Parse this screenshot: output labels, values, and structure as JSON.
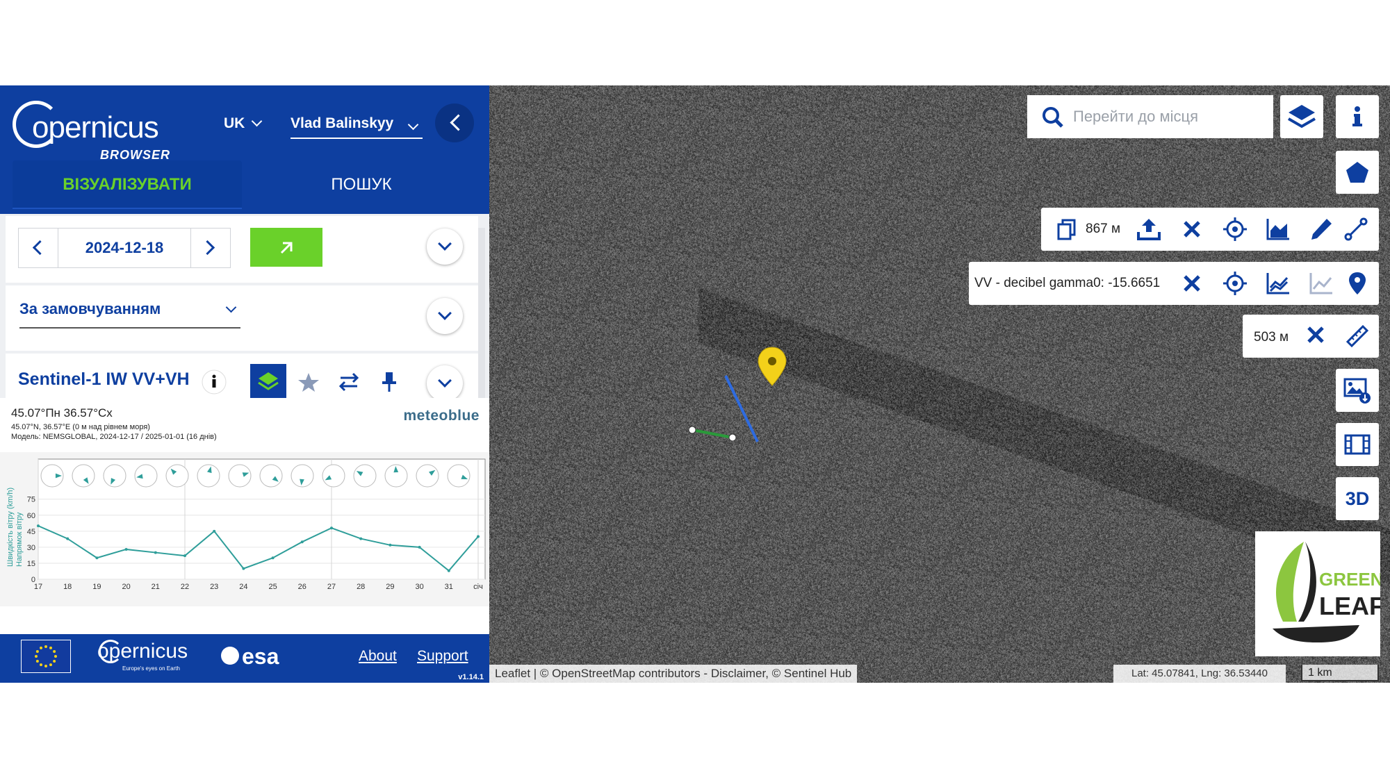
{
  "header": {
    "logo_text": "opernicus",
    "logo_sub": "BROWSER",
    "language": "UK",
    "user": "Vlad Balinskyy"
  },
  "tabs": {
    "visualize": "ВІЗУАЛІЗУВАТИ",
    "search": "ПОШУК"
  },
  "date_picker": {
    "value": "2024-12-18"
  },
  "theme": {
    "selected": "За замовчуванням"
  },
  "layer": {
    "title": "Sentinel-1 IW VV+VH"
  },
  "weather": {
    "location": "45.07°Пн 36.57°Сх",
    "coords_line": "45.07°N, 36.57°E (0 м над рівнем моря)",
    "model_line": "Модель: NEMSGLOBAL, 2024-12-17 / 2025-01-01 (16 днів)",
    "provider": "meteoblue",
    "y_axis_label1": "Швидкість вітру (km/h)",
    "y_axis_label2": "Напрямок вітру",
    "y_ticks": [
      "0",
      "15",
      "30",
      "45",
      "60",
      "75"
    ],
    "x_ticks": [
      "17",
      "18",
      "19",
      "20",
      "21",
      "22",
      "23",
      "24",
      "25",
      "26",
      "27",
      "28",
      "29",
      "30",
      "31",
      "січ"
    ]
  },
  "chart_data": {
    "type": "line",
    "x": [
      "17",
      "18",
      "19",
      "20",
      "21",
      "22",
      "23",
      "24",
      "25",
      "26",
      "27",
      "28",
      "29",
      "30",
      "31",
      "січ"
    ],
    "series": [
      {
        "values": [
          50,
          38,
          20,
          28,
          25,
          22,
          45,
          10,
          20,
          35,
          48,
          38,
          32,
          30,
          8,
          40
        ]
      }
    ],
    "ylabel": "Швидкість вітру (km/h)",
    "ylim": [
      0,
      80
    ],
    "grid": true
  },
  "footer": {
    "copernicus": "opernicus",
    "copernicus_sub": "Europe's eyes on Earth",
    "esa": "esa",
    "about": "About",
    "support": "Support",
    "version": "v1.14.1"
  },
  "map": {
    "search_placeholder": "Перейти до місця",
    "measure_area": "867 м",
    "pixel_value": "VV - decibel gamma0: -15.6651",
    "measure_distance": "503 м",
    "btn_3d": "3D",
    "attribution": "Leaflet | © OpenStreetMap contributors - Disclaimer, © Sentinel Hub",
    "coordinates": "Lat: 45.07841, Lng: 36.53440",
    "scale": "1 km",
    "sponsor_logo_line1": "GREEN",
    "sponsor_logo_line2": "LEAF"
  },
  "colors": {
    "brand_blue": "#0e3fa0",
    "accent_green": "#6ad12a",
    "chart_line": "#2f9e9a",
    "marker_yellow": "#f3d11a"
  }
}
